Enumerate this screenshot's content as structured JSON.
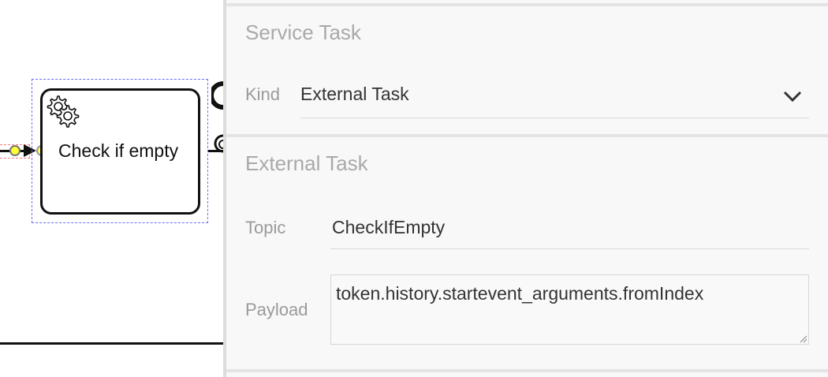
{
  "task": {
    "label": "Check if empty"
  },
  "panel": {
    "service_group_title": "Service Task",
    "kind_label": "Kind",
    "kind_value": "External Task",
    "external_group_title": "External Task",
    "topic_label": "Topic",
    "topic_value": "CheckIfEmpty",
    "payload_label": "Payload",
    "payload_value": "token.history.startevent_arguments.fromIndex"
  },
  "icons": {
    "task_type": "gear-icon",
    "select_caret": "chevron-down-icon",
    "resize": "resize-handle-icon"
  },
  "colors": {
    "selection_outline": "#6b6bff",
    "connection_point": "#ffff33",
    "panel_background": "#f8f8f8",
    "group_title": "#a9a9a9"
  }
}
